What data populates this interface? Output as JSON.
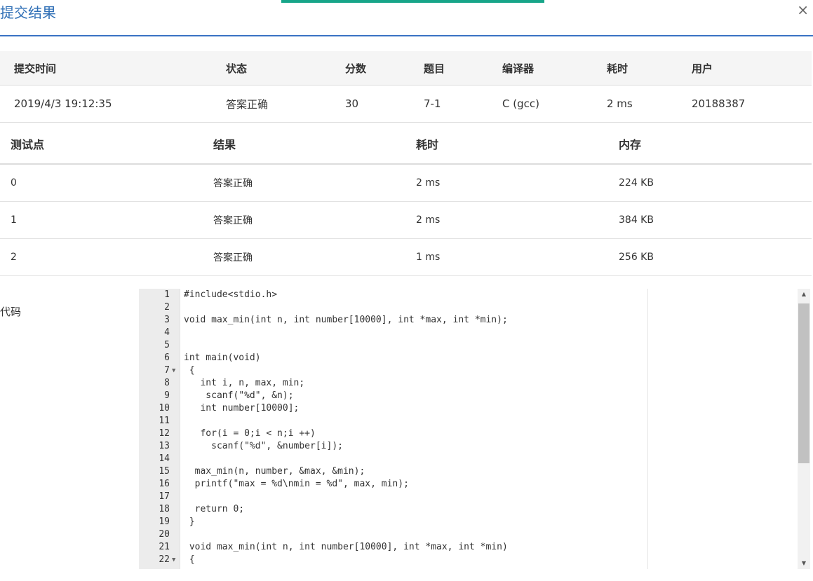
{
  "dialog": {
    "title": "提交结果",
    "close": "×"
  },
  "summary": {
    "headers": [
      "提交时间",
      "状态",
      "分数",
      "题目",
      "编译器",
      "耗时",
      "用户"
    ],
    "row": [
      "2019/4/3 19:12:35",
      "答案正确",
      "30",
      "7-1",
      "C (gcc)",
      "2 ms",
      "20188387"
    ]
  },
  "tests": {
    "headers": [
      "测试点",
      "结果",
      "耗时",
      "内存"
    ],
    "rows": [
      [
        "0",
        "答案正确",
        "2 ms",
        "224 KB"
      ],
      [
        "1",
        "答案正确",
        "2 ms",
        "384 KB"
      ],
      [
        "2",
        "答案正确",
        "1 ms",
        "256 KB"
      ]
    ]
  },
  "code_label": "代码",
  "code": [
    "#include<stdio.h>",
    "",
    "void max_min(int n, int number[10000], int *max, int *min);",
    "",
    "",
    "int main(void)",
    " {",
    "   int i, n, max, min;",
    "    scanf(\"%d\", &n);",
    "   int number[10000];",
    "",
    "   for(i = 0;i < n;i ++)",
    "     scanf(\"%d\", &number[i]);",
    "",
    "  max_min(n, number, &max, &min);",
    "  printf(\"max = %d\\nmin = %d\", max, min);",
    "",
    "  return 0;",
    " }",
    "",
    " void max_min(int n, int number[10000], int *max, int *min)",
    " {"
  ],
  "line_numbers": [
    "1",
    "2",
    "3",
    "4",
    "5",
    "6",
    "7",
    "8",
    "9",
    "10",
    "11",
    "12",
    "13",
    "14",
    "15",
    "16",
    "17",
    "18",
    "19",
    "20",
    "21",
    "22"
  ],
  "fold_markers": {
    "7": "▼",
    "22": "▼"
  },
  "scrollbar": {
    "up": "▲",
    "down": "▼"
  },
  "colors": {
    "accent": "#17a589",
    "title": "#2f6fb6",
    "success": "#d9413b"
  }
}
